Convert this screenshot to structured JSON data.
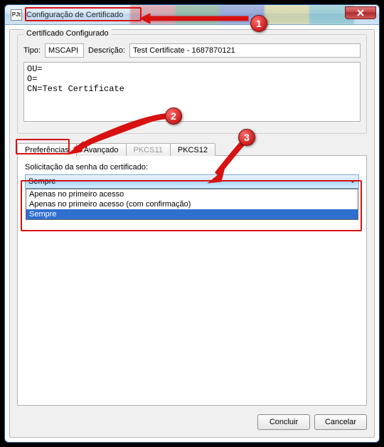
{
  "titlebar": {
    "app_icon_text": "PJt",
    "title": "Configuração de Certificado"
  },
  "group": {
    "legend": "Certificado Configurado",
    "tipo_label": "Tipo:",
    "tipo_value": "MSCAPI",
    "desc_label": "Descrição:",
    "desc_value": "Test Certificate - 1687870121",
    "details": "OU=\nO=\nCN=Test Certificate"
  },
  "tabs": {
    "items": [
      {
        "label": "Preferências",
        "state": "active"
      },
      {
        "label": "Avançado",
        "state": "normal"
      },
      {
        "label": "PKCS11",
        "state": "disabled"
      },
      {
        "label": "PKCS12",
        "state": "normal"
      }
    ]
  },
  "combo": {
    "label": "Solicitação da senha do certificado:",
    "value": "Sempre",
    "options": [
      {
        "label": "Apenas no primeiro acesso",
        "selected": false
      },
      {
        "label": "Apenas no primeiro acesso (com confirmação)",
        "selected": false
      },
      {
        "label": "Sempre",
        "selected": true
      }
    ]
  },
  "buttons": {
    "ok": "Concluir",
    "cancel": "Cancelar"
  },
  "callouts": {
    "b1": "1",
    "b2": "2",
    "b3": "3"
  }
}
